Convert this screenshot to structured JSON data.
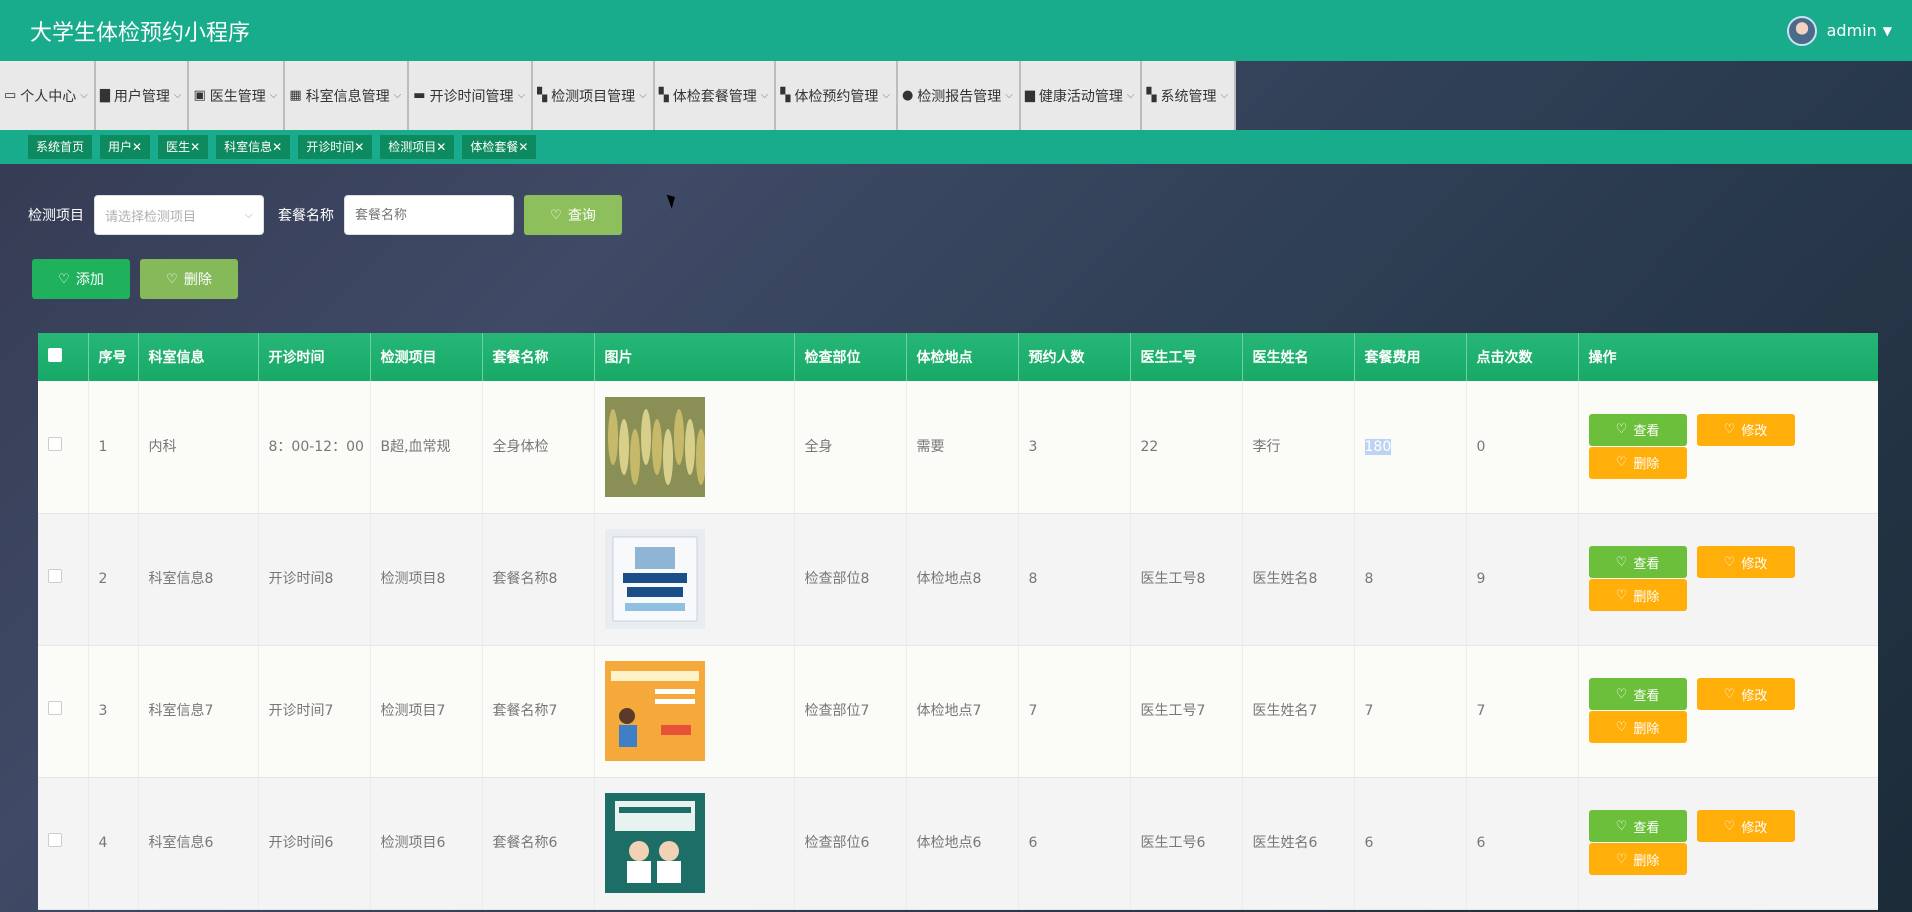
{
  "header": {
    "app_title": "大学生体检预约小程序",
    "user": "admin"
  },
  "menu": [
    {
      "label": "个人中心",
      "icon": "id-card-icon",
      "glyph": "▭"
    },
    {
      "label": "用户管理",
      "icon": "user-icon",
      "glyph": "▇"
    },
    {
      "label": "医生管理",
      "icon": "clipboard-icon",
      "glyph": "▣"
    },
    {
      "label": "科室信息管理",
      "icon": "grid-icon",
      "glyph": "▦"
    },
    {
      "label": "开诊时间管理",
      "icon": "chat-icon",
      "glyph": "▬"
    },
    {
      "label": "检测项目管理",
      "icon": "apps-icon",
      "glyph": "▚"
    },
    {
      "label": "体检套餐管理",
      "icon": "apps-icon",
      "glyph": "▚"
    },
    {
      "label": "体检预约管理",
      "icon": "apps-icon",
      "glyph": "▚"
    },
    {
      "label": "检测报告管理",
      "icon": "person-icon",
      "glyph": "●"
    },
    {
      "label": "健康活动管理",
      "icon": "desk-icon",
      "glyph": "▆"
    },
    {
      "label": "系统管理",
      "icon": "apps-icon",
      "glyph": "▚"
    }
  ],
  "tags": [
    "系统首页",
    "用户✕",
    "医生✕",
    "科室信息✕",
    "开诊时间✕",
    "检测项目✕",
    "体检套餐✕"
  ],
  "search": {
    "item_label": "检测项目",
    "item_placeholder": "请选择检测项目",
    "name_label": "套餐名称",
    "name_placeholder": "套餐名称",
    "query_label": "查询"
  },
  "actions": {
    "add_label": "添加",
    "delete_label": "删除"
  },
  "table": {
    "headers": [
      "序号",
      "科室信息",
      "开诊时间",
      "检测项目",
      "套餐名称",
      "图片",
      "检查部位",
      "体检地点",
      "预约人数",
      "医生工号",
      "医生姓名",
      "套餐费用",
      "点击次数",
      "操作"
    ],
    "rows": [
      {
        "no": "1",
        "dept": "内科",
        "time": "8：00-12：00",
        "item": "B超,血常规",
        "name": "全身体检",
        "image": "wheat-photo",
        "part": "全身",
        "place": "需要",
        "count": "3",
        "doc_id": "22",
        "doc_name": "李行",
        "fee": "180",
        "clicks": "0"
      },
      {
        "no": "2",
        "dept": "科室信息8",
        "time": "开诊时间8",
        "item": "检测项目8",
        "name": "套餐名称8",
        "image": "poster-checkup-blue",
        "part": "检查部位8",
        "place": "体检地点8",
        "count": "8",
        "doc_id": "医生工号8",
        "doc_name": "医生姓名8",
        "fee": "8",
        "clicks": "9"
      },
      {
        "no": "3",
        "dept": "科室信息7",
        "time": "开诊时间7",
        "item": "检测项目7",
        "name": "套餐名称7",
        "image": "poster-checkup-orange",
        "part": "检查部位7",
        "place": "体检地点7",
        "count": "7",
        "doc_id": "医生工号7",
        "doc_name": "医生姓名7",
        "fee": "7",
        "clicks": "7"
      },
      {
        "no": "4",
        "dept": "科室信息6",
        "time": "开诊时间6",
        "item": "检测项目6",
        "name": "套餐名称6",
        "image": "poster-checkup-green",
        "part": "检查部位6",
        "place": "体检地点6",
        "count": "6",
        "doc_id": "医生工号6",
        "doc_name": "医生姓名6",
        "fee": "6",
        "clicks": "6"
      }
    ],
    "op_view": "查看",
    "op_edit": "修改",
    "op_delete": "删除"
  },
  "colors": {
    "primary": "#18ab8c",
    "tag": "#0e8a60",
    "view": "#6bbf3b",
    "warn": "#ffae0a"
  }
}
